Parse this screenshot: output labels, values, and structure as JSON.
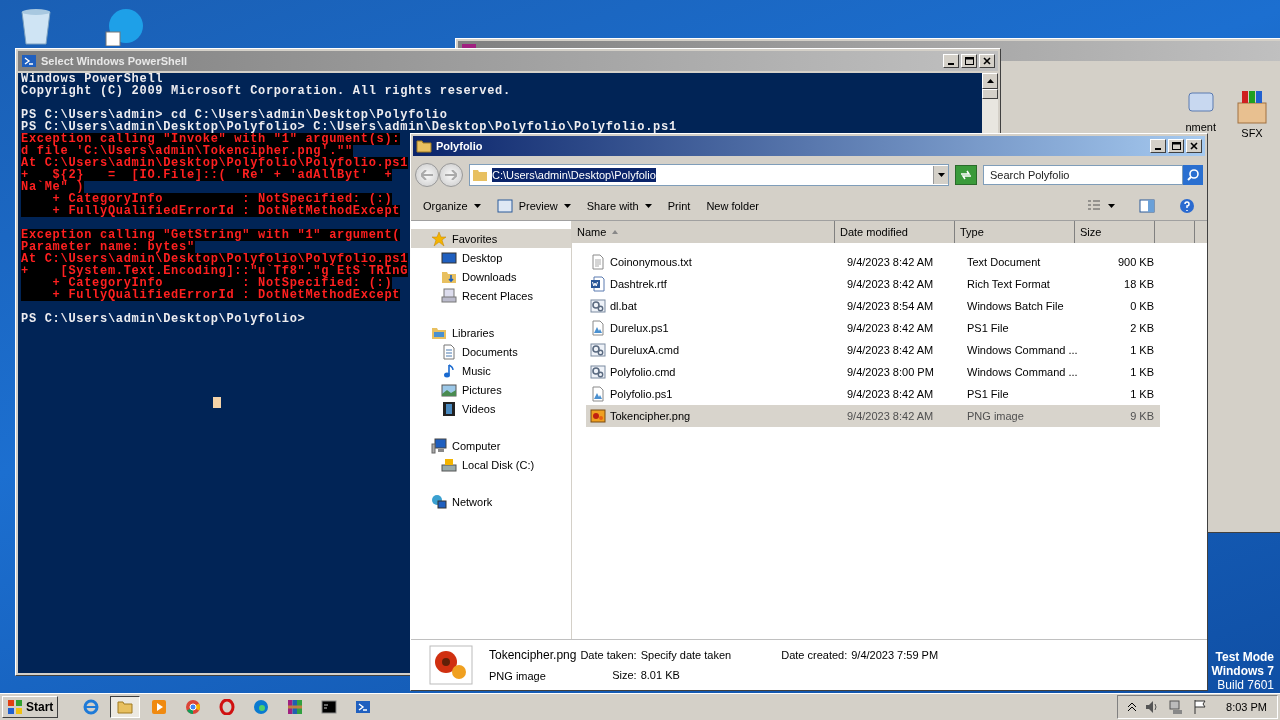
{
  "desktop": {
    "background_window": {
      "labels": [
        "nment",
        "SFX"
      ]
    },
    "watermark_text": [
      "Test Mode",
      "Windows 7",
      "Build 7601"
    ]
  },
  "powershell": {
    "title": "Select Windows PowerShell",
    "lines": [
      {
        "kind": "normal",
        "text": "Windows PowerShell"
      },
      {
        "kind": "normal",
        "text": "Copyright (C) 2009 Microsoft Corporation. All rights reserved."
      },
      {
        "kind": "blank"
      },
      {
        "kind": "normal",
        "text": "PS C:\\Users\\admin> cd C:\\Users\\admin\\Desktop\\Polyfolio"
      },
      {
        "kind": "normal",
        "text": "PS C:\\Users\\admin\\Desktop\\Polyfolio> C:\\Users\\admin\\Desktop\\Polyfolio\\Polyfolio.ps1"
      },
      {
        "kind": "error",
        "text": "Exception calling \"Invoke\" with \"1\" argument(s):"
      },
      {
        "kind": "error",
        "text": "d file 'C:\\Users\\admin\\Tokencipher.png'.\"\""
      },
      {
        "kind": "error",
        "text": "At C:\\Users\\admin\\Desktop\\Polyfolio\\Polyfolio.ps1"
      },
      {
        "kind": "error",
        "text": "+   ${2}   =  [IO.File]::( 'Re' + 'adAllByt'  +"
      },
      {
        "kind": "error",
        "text": "Na`Me\" )"
      },
      {
        "kind": "error",
        "text": "    + CategoryInfo          : NotSpecified: (:)"
      },
      {
        "kind": "error",
        "text": "    + FullyQualifiedErrorId : DotNetMethodExcept"
      },
      {
        "kind": "blank"
      },
      {
        "kind": "error",
        "text": "Exception calling \"GetString\" with \"1\" argument("
      },
      {
        "kind": "error",
        "text": "Parameter name: bytes\""
      },
      {
        "kind": "error",
        "text": "At C:\\Users\\admin\\Desktop\\Polyfolio\\Polyfolio.ps1"
      },
      {
        "kind": "error",
        "text": "+    [System.Text.Encoding]::\"u`Tf8\".\"g`EtS`TRInG"
      },
      {
        "kind": "error",
        "text": "    + CategoryInfo          : NotSpecified: (:)"
      },
      {
        "kind": "error",
        "text": "    + FullyQualifiedErrorId : DotNetMethodExcept"
      },
      {
        "kind": "blank"
      },
      {
        "kind": "normal",
        "text": "PS C:\\Users\\admin\\Desktop\\Polyfolio>"
      }
    ]
  },
  "explorer": {
    "title": "Polyfolio",
    "address": "C:\\Users\\admin\\Desktop\\Polyfolio",
    "search": {
      "placeholder": "Search Polyfolio"
    },
    "toolbar": [
      {
        "label": "Organize",
        "dropdown": true
      },
      {
        "label": "Preview",
        "dropdown": true
      },
      {
        "label": "Share with",
        "dropdown": true
      },
      {
        "label": "Print",
        "dropdown": false
      },
      {
        "label": "New folder",
        "dropdown": false
      }
    ],
    "nav": [
      {
        "label": "Favorites",
        "kind": "star",
        "selected": true,
        "children": [
          {
            "label": "Desktop",
            "kind": "desktop",
            "selected": false
          },
          {
            "label": "Downloads",
            "kind": "downloads",
            "selected": false
          },
          {
            "label": "Recent Places",
            "kind": "recent",
            "selected": false
          }
        ]
      },
      {
        "label": "Libraries",
        "kind": "library",
        "selected": false,
        "children": [
          {
            "label": "Documents",
            "kind": "document",
            "selected": false
          },
          {
            "label": "Music",
            "kind": "music",
            "selected": false
          },
          {
            "label": "Pictures",
            "kind": "pictures",
            "selected": false
          },
          {
            "label": "Videos",
            "kind": "video",
            "selected": false
          }
        ]
      },
      {
        "label": "Computer",
        "kind": "computer",
        "selected": false,
        "children": [
          {
            "label": "Local Disk (C:)",
            "kind": "disk",
            "selected": false
          }
        ]
      },
      {
        "label": "Network",
        "kind": "network",
        "selected": false
      }
    ],
    "columns": [
      "Name",
      "Date modified",
      "Type",
      "Size"
    ],
    "rows": [
      {
        "kind": "text",
        "name": "Coinonymous.txt",
        "date": "9/4/2023 8:42 AM",
        "type": "Text Document",
        "size": "900 KB",
        "selected": false
      },
      {
        "kind": "word",
        "name": "Dashtrek.rtf",
        "date": "9/4/2023 8:42 AM",
        "type": "Rich Text Format",
        "size": "18 KB",
        "selected": false
      },
      {
        "kind": "script",
        "name": "dl.bat",
        "date": "9/4/2023 8:54 AM",
        "type": "Windows Batch File",
        "size": "0 KB",
        "selected": false
      },
      {
        "kind": "ps1",
        "name": "Durelux.ps1",
        "date": "9/4/2023 8:42 AM",
        "type": "PS1 File",
        "size": "2 KB",
        "selected": false
      },
      {
        "kind": "script",
        "name": "DureluxA.cmd",
        "date": "9/4/2023 8:42 AM",
        "type": "Windows Command ...",
        "size": "1 KB",
        "selected": false
      },
      {
        "kind": "script",
        "name": "Polyfolio.cmd",
        "date": "9/4/2023 8:00 PM",
        "type": "Windows Command ...",
        "size": "1 KB",
        "selected": false
      },
      {
        "kind": "ps1",
        "name": "Polyfolio.ps1",
        "date": "9/4/2023 8:42 AM",
        "type": "PS1 File",
        "size": "1 KB",
        "selected": false
      },
      {
        "kind": "image",
        "name": "Tokencipher.png",
        "date": "9/4/2023 8:42 AM",
        "type": "PNG image",
        "size": "9 KB",
        "selected": true
      }
    ],
    "details": {
      "name": "Tokencipher.png",
      "type": "PNG image",
      "fields": [
        {
          "label": "Date taken:",
          "value": "Specify date taken"
        },
        {
          "label": "Size:",
          "value": "8.01 KB"
        },
        {
          "label": "Date created:",
          "value": "9/4/2023 7:59 PM"
        }
      ]
    }
  },
  "taskbar": {
    "start": "Start",
    "apps": [
      {
        "kind": "ie",
        "selected": false
      },
      {
        "kind": "folder",
        "selected": true
      },
      {
        "kind": "media",
        "selected": false
      },
      {
        "kind": "chrome",
        "selected": false
      },
      {
        "kind": "opera",
        "selected": false
      },
      {
        "kind": "edge",
        "selected": false
      },
      {
        "kind": "winrar",
        "selected": false
      },
      {
        "kind": "cmd",
        "selected": false
      },
      {
        "kind": "powershell",
        "selected": false
      }
    ],
    "clock": "8:03 PM"
  }
}
